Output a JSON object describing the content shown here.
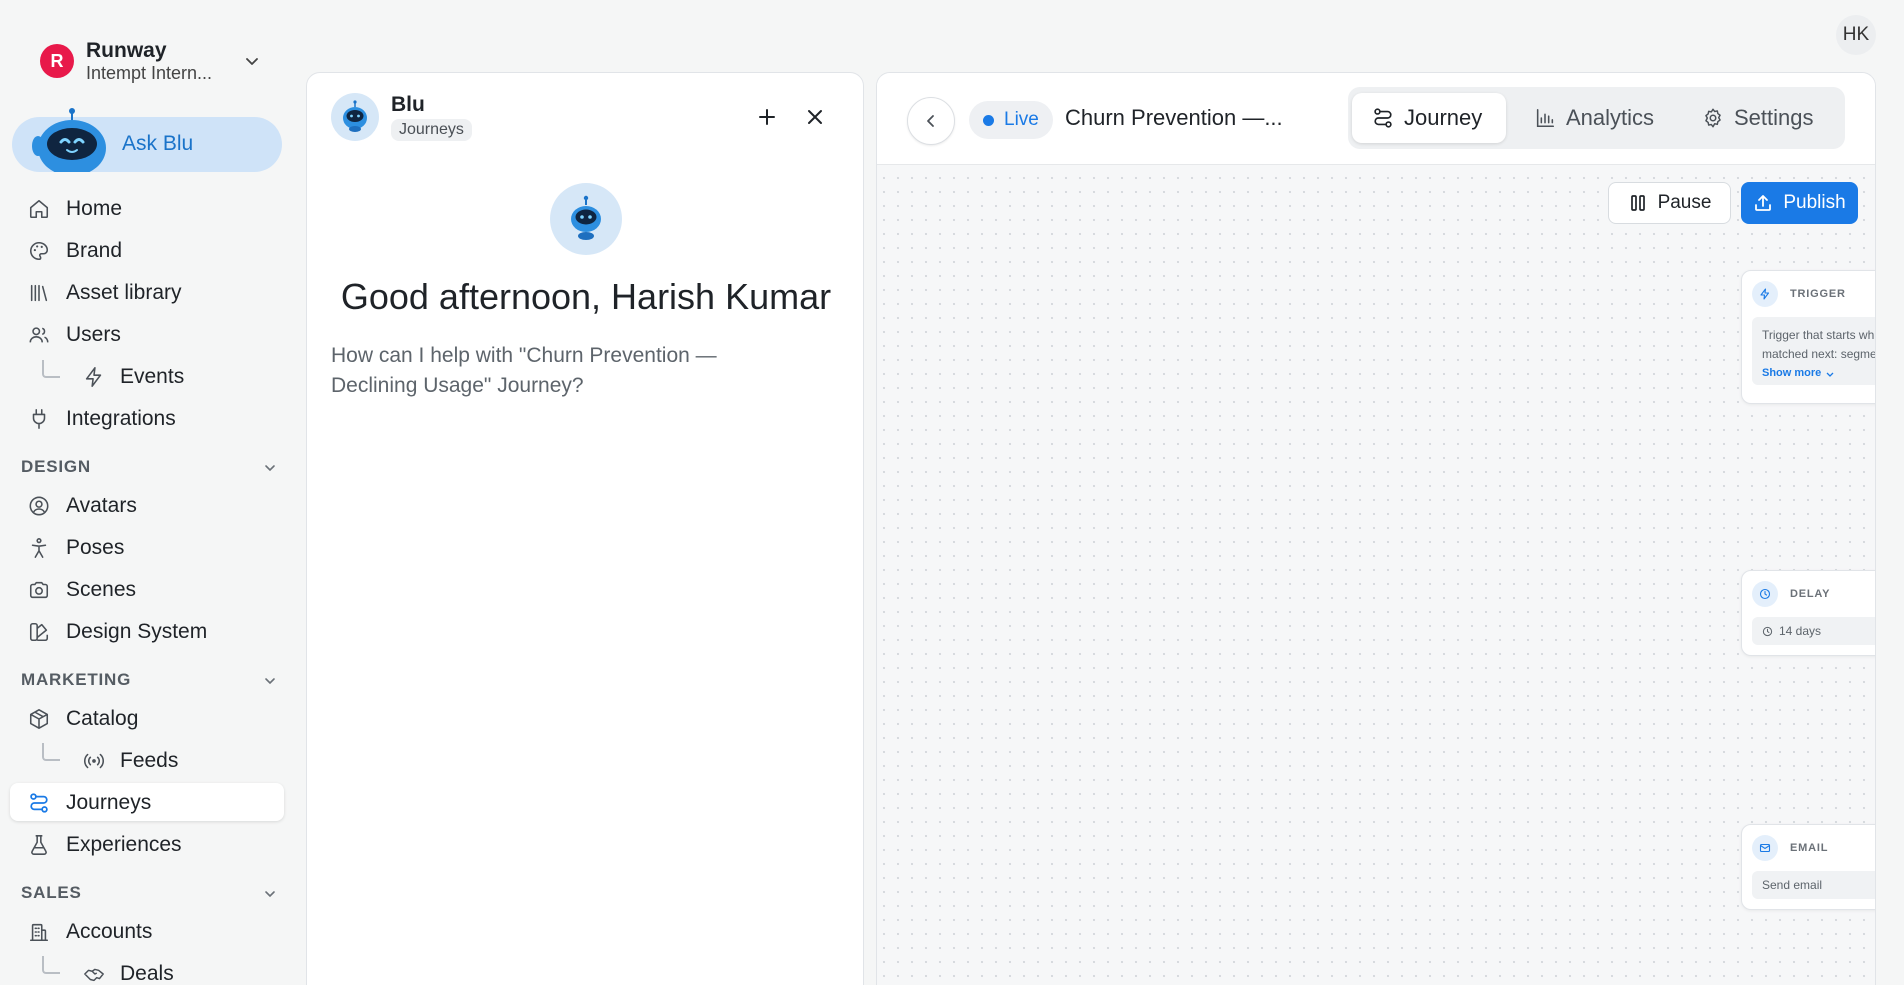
{
  "org": {
    "initial": "R",
    "name": "Runway",
    "subtitle": "Intempt Intern..."
  },
  "ask_blu": {
    "label": "Ask Blu"
  },
  "nav": {
    "home": "Home",
    "brand": "Brand",
    "asset_library": "Asset library",
    "users": "Users",
    "events": "Events",
    "integrations": "Integrations",
    "design_section": "DESIGN",
    "avatars": "Avatars",
    "poses": "Poses",
    "scenes": "Scenes",
    "design_system": "Design System",
    "marketing_section": "MARKETING",
    "catalog": "Catalog",
    "feeds": "Feeds",
    "journeys": "Journeys",
    "experiences": "Experiences",
    "sales_section": "SALES",
    "accounts": "Accounts",
    "deals": "Deals"
  },
  "user": {
    "initials": "HK"
  },
  "chat": {
    "title": "Blu",
    "badge": "Journeys",
    "greeting": "Good afternoon, Harish Kumar",
    "help": "How can I help with \"Churn Prevention — Declining Usage\" Journey?"
  },
  "journey": {
    "status": "Live",
    "title": "Churn Prevention —...",
    "tabs": [
      "Journey",
      "Analytics",
      "Settings"
    ],
    "active_tab": "Journey",
    "pause_label": "Pause",
    "publish_label": "Publish",
    "nodes": {
      "trigger": {
        "label": "TRIGGER",
        "text_1": "Trigger that starts wh",
        "text_2": "matched next: segme",
        "more": "Show more"
      },
      "delay": {
        "label": "DELAY",
        "value": "14 days"
      },
      "email": {
        "label": "EMAIL",
        "value": "Send email"
      }
    }
  },
  "colors": {
    "accent": "#1a7ae6",
    "org_badge": "#e8194a",
    "ask_blu_bg": "#cfe3f8"
  }
}
